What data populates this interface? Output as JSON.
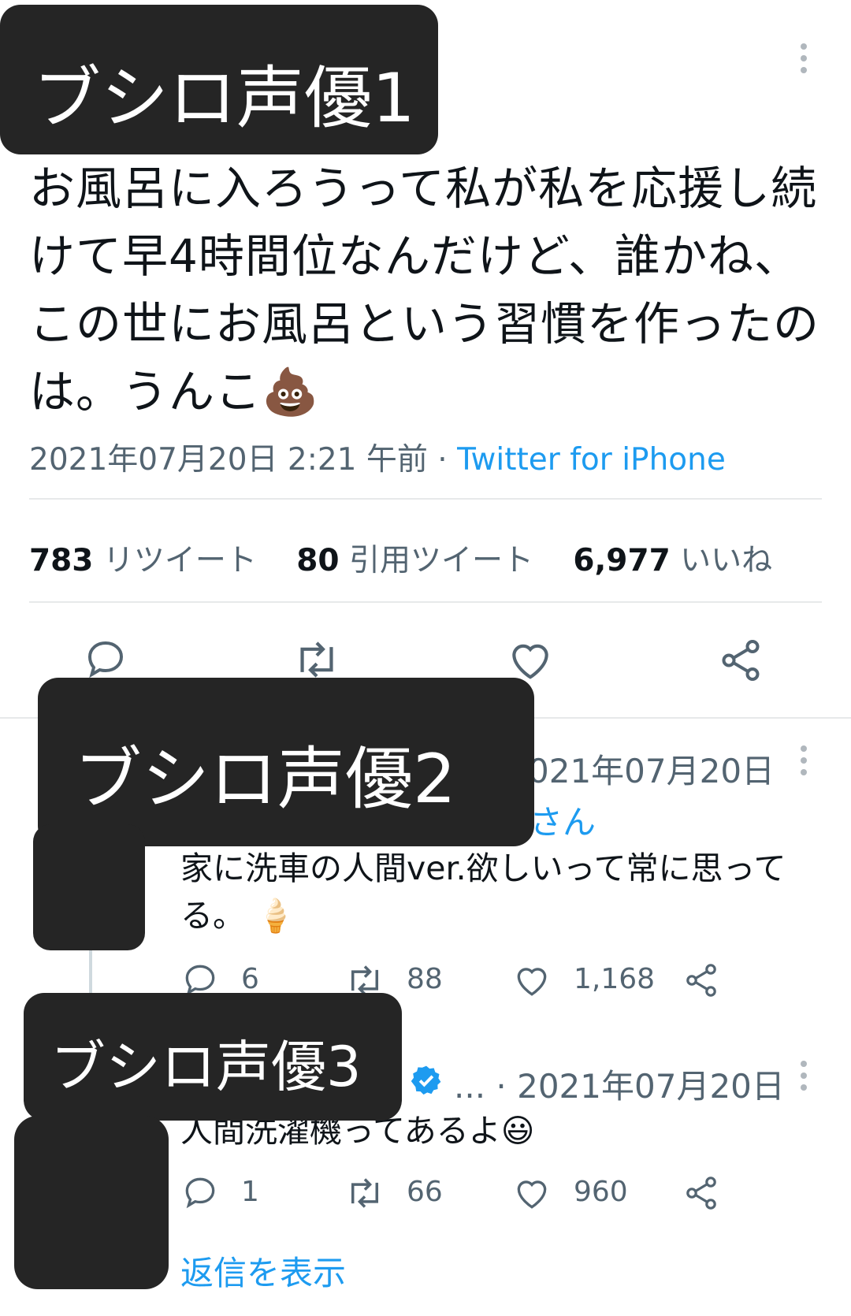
{
  "labels": {
    "voice1": "ブシロ声優1",
    "voice2": "ブシロ声優2",
    "voice3": "ブシロ声優3"
  },
  "main_tweet": {
    "text": "お風呂に入ろうって私が私を応援し続けて早4時間位なんだけど、誰かね、この世にお風呂という習慣を作ったのは。うんこ",
    "emoji": "💩",
    "date": "2021年07月20日 2:21 午前",
    "separator": " · ",
    "source": "Twitter for iPhone",
    "retweets": "783",
    "retweets_label": "リツイート",
    "quotes": "80",
    "quotes_label": "引用ツイート",
    "likes": "6,977",
    "likes_label": "いいね"
  },
  "reply1": {
    "date": "021年07月20日",
    "handle_suffix": "さん",
    "text": "家に洗車の人間ver.欲しいって常に思ってる。",
    "emoji": "🍦",
    "reply_count": "6",
    "retweet_count": "88",
    "like_count": "1,168"
  },
  "reply2": {
    "date_prefix": "... · ",
    "date": "2021年07月20日",
    "text": "人間洗濯機ってあるよ",
    "emoji": "😃",
    "reply_count": "1",
    "retweet_count": "66",
    "like_count": "960"
  },
  "show_replies": "返信を表示",
  "colors": {
    "accent": "#1d9bf0",
    "text": "#0f1419",
    "muted": "#536471",
    "redaction": "#252525"
  },
  "icons": [
    "more-icon",
    "reply-icon",
    "retweet-icon",
    "like-icon",
    "share-icon",
    "verified-icon"
  ]
}
